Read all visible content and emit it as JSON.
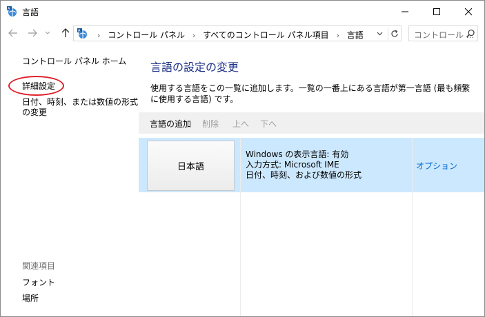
{
  "window": {
    "title": "言語"
  },
  "address": {
    "crumbs": [
      "コントロール パネル",
      "すべてのコントロール パネル項目",
      "言語"
    ]
  },
  "search": {
    "placeholder": "コントロール ..."
  },
  "sidebar": {
    "home": "コントロール パネル ホーム",
    "advanced": "詳細設定",
    "format": "日付、時刻、または数値の形式の変更",
    "related_heading": "関連項目",
    "fonts": "フォント",
    "location": "場所"
  },
  "main": {
    "title": "言語の設定の変更",
    "description": "使用する言語をこの一覧に追加します。一覧の一番上にある言語が第一言語 (最も頻繁に使用する言語) です。",
    "toolbar": {
      "add": "言語の追加",
      "remove": "削除",
      "up": "上へ",
      "down": "下へ"
    },
    "languages": [
      {
        "name": "日本語",
        "display_language": "Windows の表示言語: 有効",
        "input_method": "入力方式: Microsoft IME",
        "format": "日付、時刻、および数値の形式",
        "options": "オプション"
      }
    ]
  },
  "colors": {
    "title_blue": "#1e3287",
    "link_blue": "#0066cc",
    "selection": "#cce8ff",
    "annotation_red": "#e0202a"
  }
}
